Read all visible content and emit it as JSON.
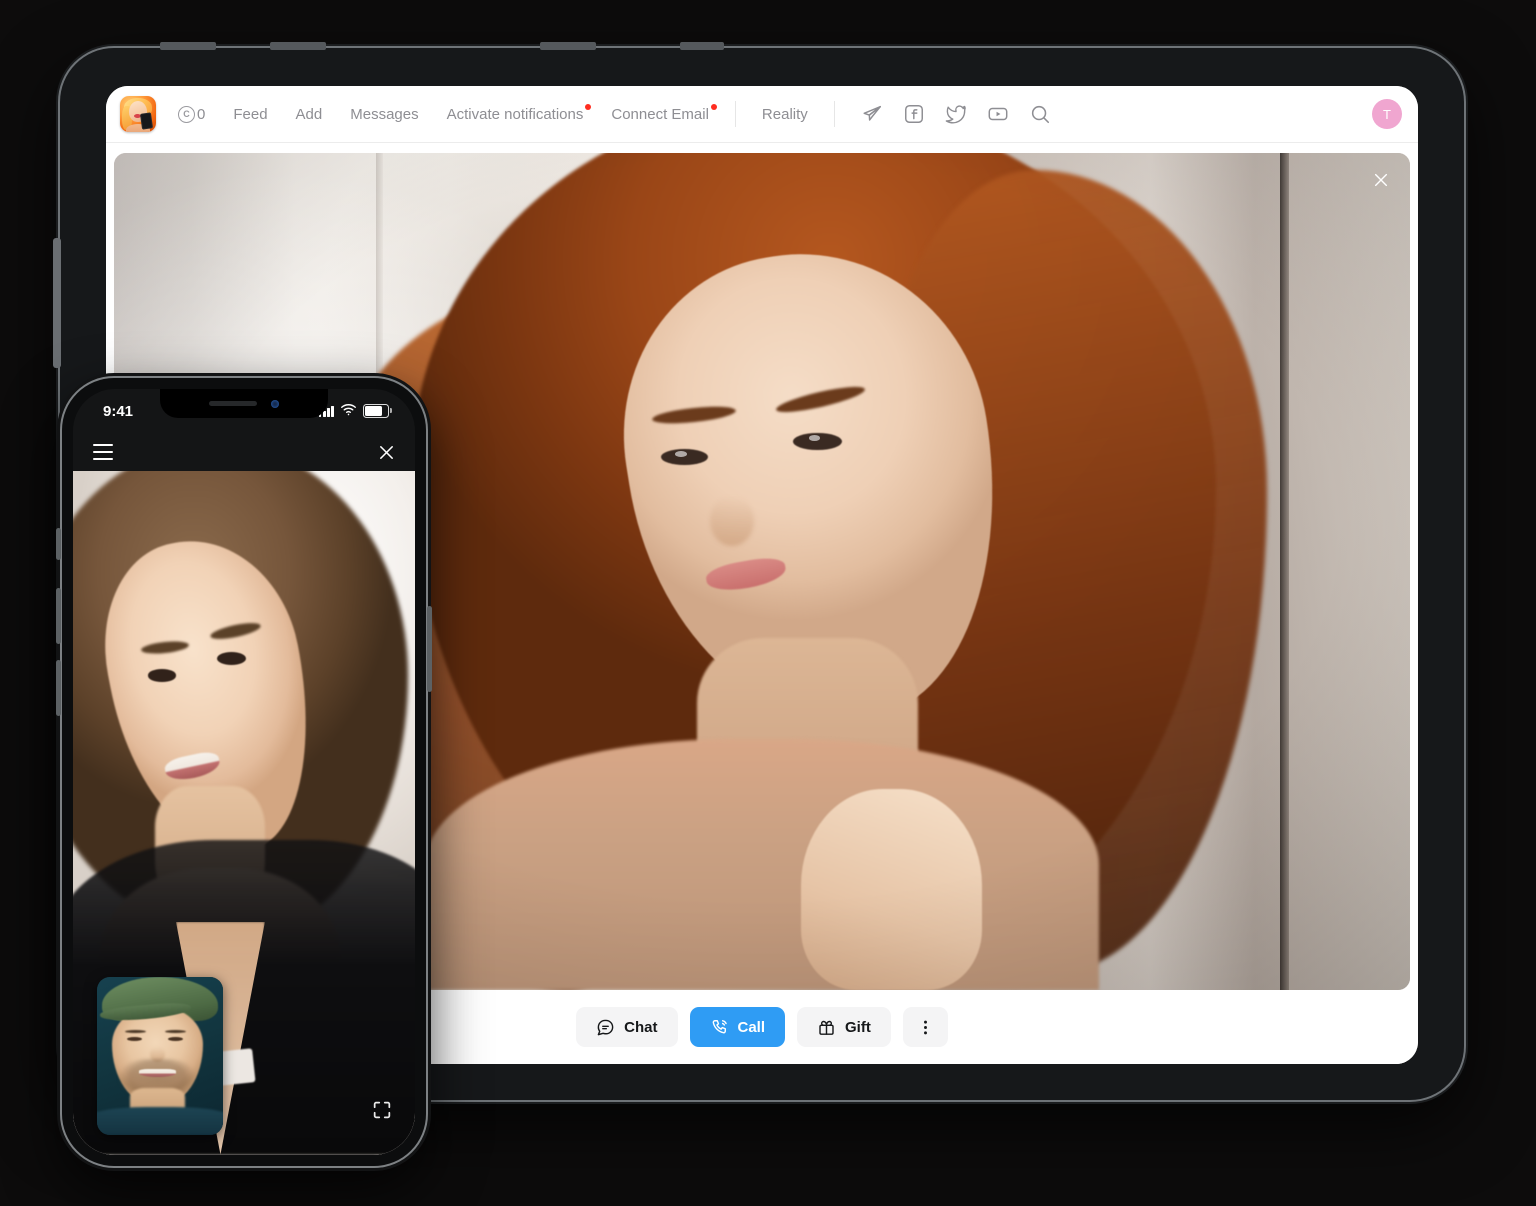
{
  "app": {
    "background_color": "#0d0c0c",
    "accent_color": "#2f9cf4",
    "badge_color": "#ff2d20",
    "avatar_color": "#f0a6d0"
  },
  "tablet": {
    "navbar": {
      "logo_icon": "app-logo-woman-phone",
      "coin": {
        "icon": "coin-icon",
        "symbol": "C",
        "value": "0"
      },
      "links": [
        {
          "label": "Feed",
          "badge": false
        },
        {
          "label": "Add",
          "badge": false
        },
        {
          "label": "Messages",
          "badge": false
        },
        {
          "label": "Activate notifications",
          "badge": true
        },
        {
          "label": "Connect Email",
          "badge": true
        }
      ],
      "secondary_links": [
        {
          "label": "Reality",
          "badge": false
        }
      ],
      "social_icons": [
        "telegram-icon",
        "facebook-icon",
        "twitter-icon",
        "youtube-icon",
        "search-icon"
      ],
      "avatar_initial": "T"
    },
    "video": {
      "close_icon": "close-icon",
      "subject": "remote-participant-video"
    },
    "actionbar": {
      "buttons": [
        {
          "label": "Chat",
          "icon": "chat-bubble-icon",
          "style": "secondary"
        },
        {
          "label": "Call",
          "icon": "phone-call-icon",
          "style": "primary"
        },
        {
          "label": "Gift",
          "icon": "gift-icon",
          "style": "secondary"
        }
      ],
      "more_icon": "more-vertical-icon"
    }
  },
  "phone": {
    "status_bar": {
      "time": "9:41",
      "signal_icon": "cellular-signal-icon",
      "wifi_icon": "wifi-icon",
      "battery_icon": "battery-icon"
    },
    "topbar": {
      "menu_icon": "hamburger-menu-icon",
      "close_icon": "close-icon"
    },
    "video": {
      "subject": "remote-participant-video",
      "pip_subject": "self-view-video",
      "expand_icon": "fullscreen-expand-icon"
    }
  }
}
